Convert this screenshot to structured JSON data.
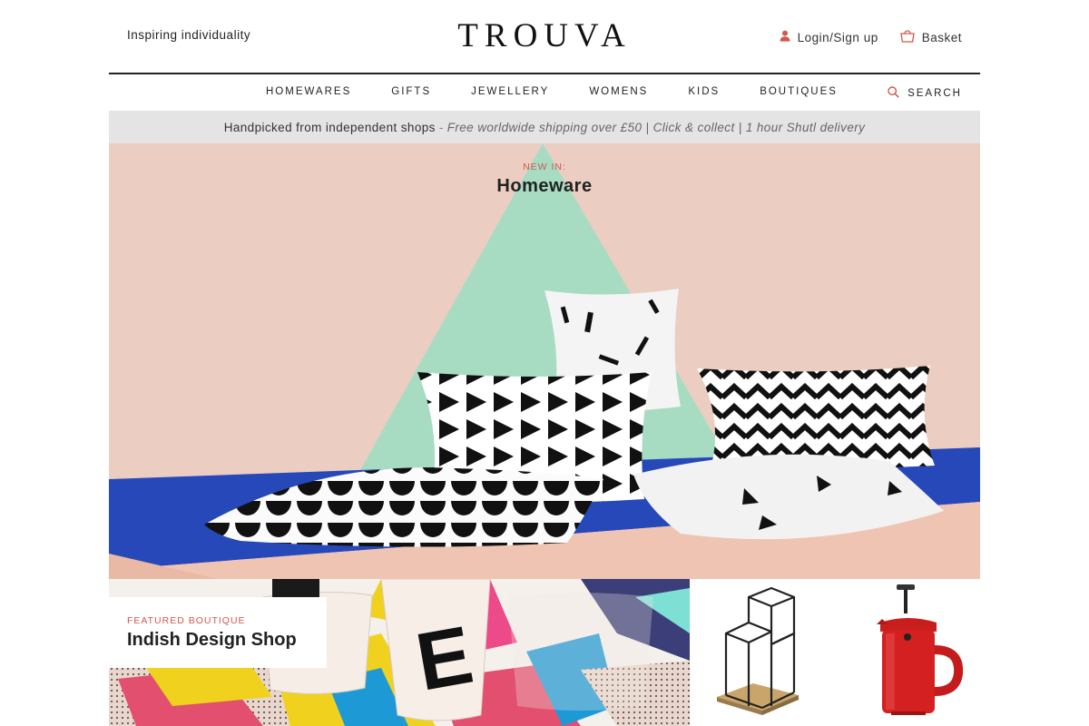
{
  "header": {
    "tagline": "Inspiring individuality",
    "logo": "TROUVA",
    "login_label": "Login/Sign up",
    "basket_label": "Basket"
  },
  "nav": {
    "items": [
      "HOMEWARES",
      "GIFTS",
      "JEWELLERY",
      "WOMENS",
      "KIDS",
      "BOUTIQUES"
    ],
    "search_label": "SEARCH"
  },
  "promo": {
    "main": "Handpicked from independent shops",
    "separator": "-",
    "offers": "Free worldwide shipping over £50 | Click & collect | 1 hour Shutl delivery"
  },
  "hero": {
    "eyebrow": "NEW IN:",
    "title": "Homeware"
  },
  "featured": {
    "eyebrow": "FEATURED BOUTIQUE",
    "title": "Indish Design Shop"
  },
  "colors": {
    "accent": "#d0584e",
    "promo_bg": "#e4e4e4",
    "rule": "#222222"
  },
  "icons": {
    "login": "user-icon",
    "basket": "basket-icon",
    "search": "search-icon"
  }
}
